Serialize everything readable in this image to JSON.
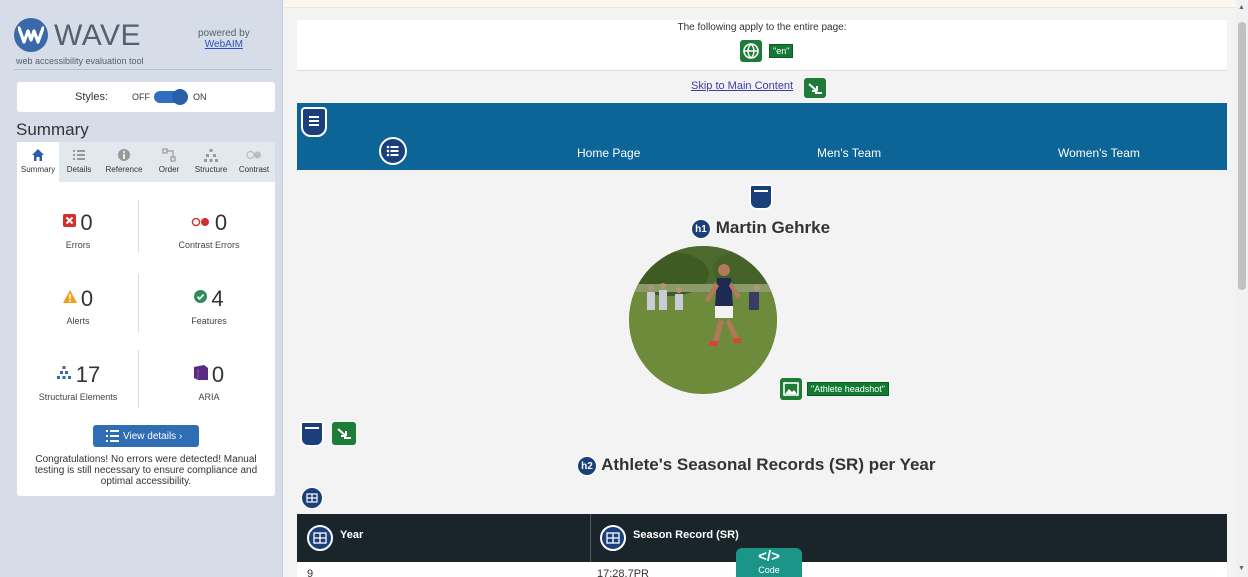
{
  "wave": {
    "brand_name": "WAVE",
    "tagline": "web accessibility evaluation tool",
    "powered_by": "powered by",
    "powered_link": "WebAIM",
    "styles_label": "Styles:",
    "styles_off": "OFF",
    "styles_on": "ON",
    "styles_enabled": true,
    "summary_title": "Summary",
    "tabs": [
      {
        "label": "Summary",
        "icon": "home-icon",
        "active": true
      },
      {
        "label": "Details",
        "icon": "list-icon",
        "active": false
      },
      {
        "label": "Reference",
        "icon": "info-icon",
        "active": false
      },
      {
        "label": "Order",
        "icon": "order-icon",
        "active": false
      },
      {
        "label": "Structure",
        "icon": "structure-icon",
        "active": false
      },
      {
        "label": "Contrast",
        "icon": "contrast-icon",
        "active": false
      }
    ],
    "stats": [
      {
        "count": "0",
        "label": "Errors",
        "icon": "error-icon",
        "color": "#d32f2f"
      },
      {
        "count": "0",
        "label": "Contrast Errors",
        "icon": "contrast-error-icon",
        "color": "#d32f2f"
      },
      {
        "count": "0",
        "label": "Alerts",
        "icon": "alert-icon",
        "color": "#f0a01d"
      },
      {
        "count": "4",
        "label": "Features",
        "icon": "feature-icon",
        "color": "#2e8b57"
      },
      {
        "count": "17",
        "label": "Structural Elements",
        "icon": "structure-icon",
        "color": "#3a68a8"
      },
      {
        "count": "0",
        "label": "ARIA",
        "icon": "aria-icon",
        "color": "#5a2a82"
      }
    ],
    "view_details": "View details ›",
    "congrats": "Congratulations! No errors were detected! Manual testing is still necessary to ensure compliance and optimal accessibility."
  },
  "page": {
    "lang_notice": "The following apply to the entire page:",
    "lang_tag": "\"en\"",
    "skip_link": "Skip to Main Content",
    "nav_items": [
      "Home Page",
      "Men's Team",
      "Women's Team"
    ],
    "h1_badge": "h1",
    "title": "Martin Gehrke",
    "alt_tag": "\"Athlete headshot\"",
    "h2_badge": "h2",
    "section_title": "Athlete's Seasonal Records (SR) per Year",
    "table_headers": [
      "Year",
      "Season Record (SR)"
    ],
    "table_rows": [
      [
        "9",
        "17:28.7PR"
      ]
    ],
    "code_label": "Code",
    "code_glyph": "</>"
  },
  "colors": {
    "nav_bg": "#0c6596",
    "feature_green": "#1e7b38",
    "structure_navy": "#1b3f7a",
    "table_head": "#1a252b",
    "code_teal": "#1a9587"
  }
}
